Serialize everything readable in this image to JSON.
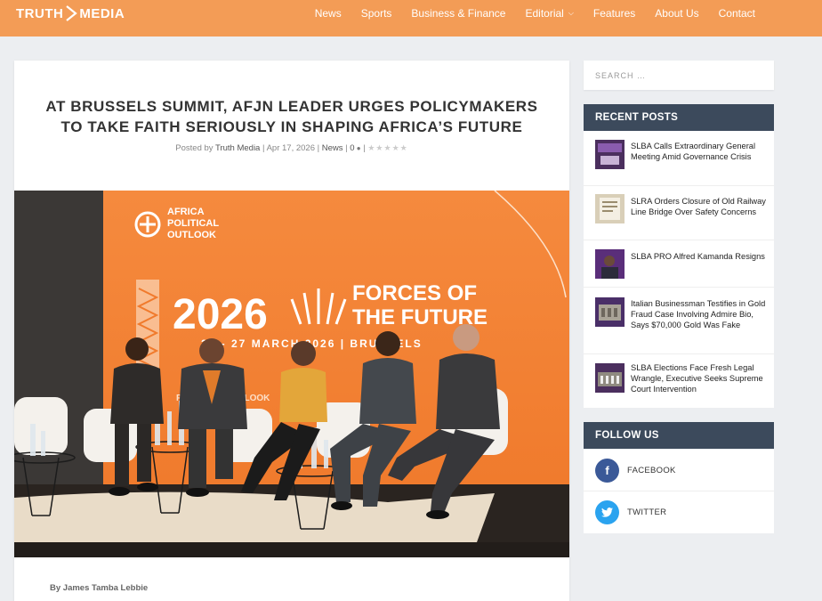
{
  "header": {
    "logo_left": "TRUTH",
    "logo_right": "MEDIA",
    "nav": [
      {
        "label": "News"
      },
      {
        "label": "Sports"
      },
      {
        "label": "Business & Finance"
      },
      {
        "label": "Editorial"
      },
      {
        "label": "Features"
      },
      {
        "label": "About Us"
      },
      {
        "label": "Contact"
      }
    ]
  },
  "article": {
    "title": "AT BRUSSELS SUMMIT, AFJN LEADER URGES POLICYMAKERS TO TAKE FAITH SERIOUSLY IN SHAPING AFRICA’S FUTURE",
    "meta_prefix": "Posted by",
    "author": "Truth Media",
    "date": "Apr 17, 2026",
    "category": "News",
    "comments": "0",
    "sep": "|",
    "byline": "By James Tamba Lebbie",
    "stage": {
      "logo_line1": "AFRICA",
      "logo_line2": "POLITICAL",
      "logo_line3": "OUTLOOK",
      "year": "2026",
      "headline_line1": "FORCES OF",
      "headline_line2": "THE FUTURE",
      "dates": "26 - 27 MARCH 2026 | BRUSSELS",
      "podium": "POLITICAL OUTLOOK"
    }
  },
  "sidebar": {
    "search_placeholder": "SEARCH …",
    "recent_title": "RECENT POSTS",
    "recent_posts": [
      {
        "title": "SLBA Calls Extraordinary General Meeting Amid Governance Crisis"
      },
      {
        "title": "SLRA Orders Closure of Old Railway Line Bridge Over Safety Concerns"
      },
      {
        "title": "SLBA PRO Alfred Kamanda Resigns"
      },
      {
        "title": "Italian Businessman Testifies in Gold Fraud Case Involving Admire Bio, Says $70,000 Gold Was Fake"
      },
      {
        "title": "SLBA Elections Face Fresh Legal Wrangle, Executive Seeks Supreme Court Intervention"
      }
    ],
    "follow_title": "FOLLOW US",
    "social": [
      {
        "label": "FACEBOOK",
        "glyph": "f",
        "color": "#3b5998",
        "icon": "facebook-icon"
      },
      {
        "label": "TWITTER",
        "glyph": "t",
        "color": "#2aa3ef",
        "icon": "twitter-icon"
      }
    ]
  },
  "colors": {
    "header": "#f39c56",
    "widget_head": "#3c4a5c",
    "page_bg": "#eceef1"
  }
}
